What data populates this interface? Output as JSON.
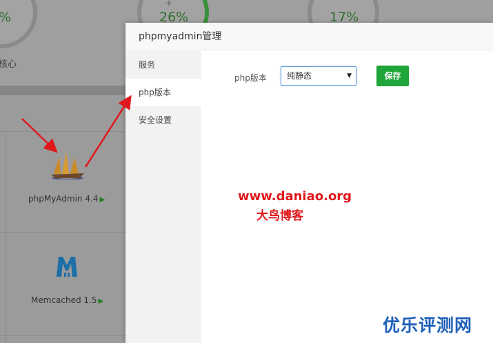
{
  "background": {
    "gauges": [
      {
        "value": "%"
      },
      {
        "value": "26%"
      },
      {
        "value": "17%"
      }
    ],
    "gauge_caption": "核心",
    "apps": [
      {
        "label": "phpMyAdmin 4.4",
        "icon": "sailboat-icon"
      },
      {
        "label": "Memcached 1.5",
        "icon": "memcached-m-icon"
      }
    ]
  },
  "modal": {
    "title": "phpmyadmin管理",
    "sidebar": [
      {
        "label": "服务"
      },
      {
        "label": "php版本"
      },
      {
        "label": "安全设置"
      }
    ],
    "active_index": 1,
    "php_version_label": "php版本",
    "php_version_selected": "纯静态",
    "save_label": "保存"
  },
  "watermarks": {
    "url": "www.daniao.org",
    "name": "大鸟博客",
    "corner": "优乐评测网"
  },
  "colors": {
    "save_button": "#20a53a",
    "annotation_red": "#e0171b",
    "corner_blue": "#1d5fb8",
    "gauge_green": "#3a8f3a"
  }
}
